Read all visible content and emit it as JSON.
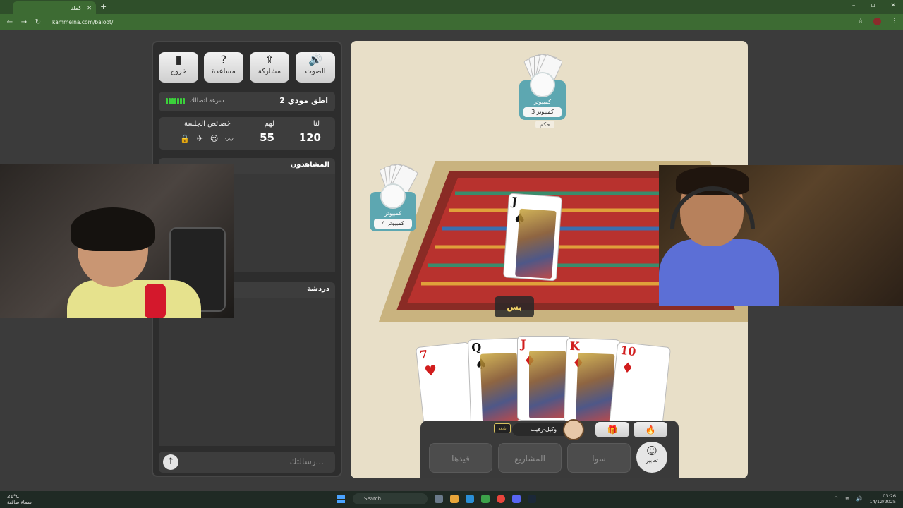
{
  "browser": {
    "tab_title": "كملنا",
    "url": "kammelna.com/baloot/",
    "new_tab": "+",
    "win_min": "–",
    "win_max": "▫",
    "win_close": "✕"
  },
  "panel": {
    "buttons": [
      {
        "label": "الصوت",
        "icon": "speaker-icon"
      },
      {
        "label": "مشاركة",
        "icon": "share-icon"
      },
      {
        "label": "مساعدة",
        "icon": "help-icon"
      },
      {
        "label": "خروج",
        "icon": "exit-door-icon"
      }
    ],
    "room_name": "اطق مودي 2",
    "connection_label": "سرعة اتصالك",
    "score": {
      "us_label": "لنا",
      "them_label": "لهم",
      "session_label": "خصائص الجلسة",
      "us_value": "120",
      "them_value": "55"
    },
    "watchers_title": "المشاهدون",
    "chat_title": "دردشة",
    "message_placeholder": "رسالتك..."
  },
  "game": {
    "top_player": {
      "name": "كمبيوتر",
      "label": "كمبيوتر 3",
      "role": "حكم"
    },
    "left_player": {
      "name": "كمبيوتر",
      "label": "كمبيوتر 4"
    },
    "center_card": {
      "rank": "J",
      "suit": "♠"
    },
    "pass_bubble": "بس",
    "hand": [
      {
        "rank": "7",
        "suit": "♥",
        "color": "red"
      },
      {
        "rank": "Q",
        "suit": "♠",
        "color": "black"
      },
      {
        "rank": "J",
        "suit": "♦",
        "color": "red"
      },
      {
        "rank": "K",
        "suit": "♦",
        "color": "red"
      },
      {
        "rank": "10",
        "suit": "♦",
        "color": "red"
      }
    ],
    "controls": {
      "qaydha": "قيدها",
      "mashari": "المشاريع",
      "sawa": "سوا",
      "emoji_label": "تعابير",
      "partner_name": "وكيل-رقيب",
      "badge": "نابغة"
    }
  },
  "taskbar": {
    "weather_temp": "21°C",
    "weather_desc": "سماء صافية",
    "search": "Search",
    "time": "03:26",
    "date": "14/12/2025"
  }
}
